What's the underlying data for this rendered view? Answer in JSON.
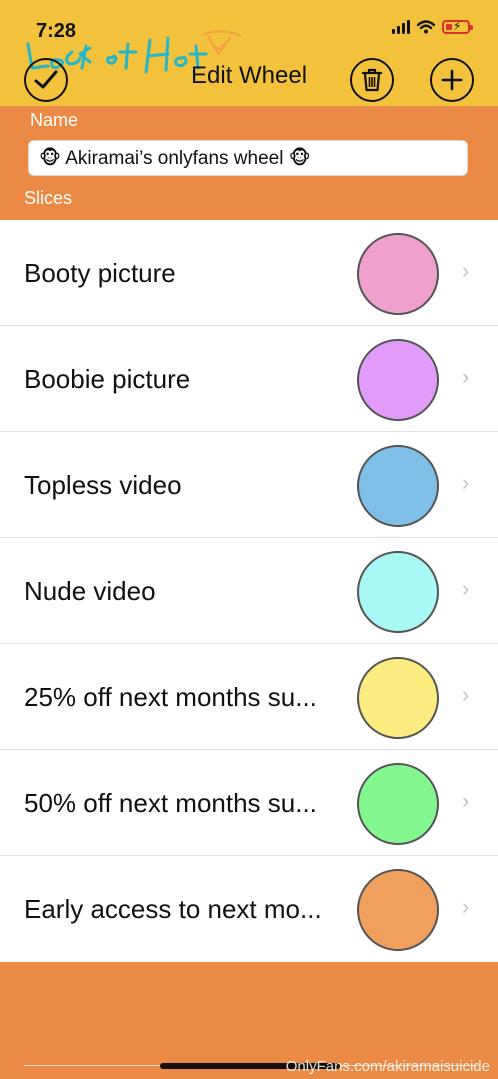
{
  "status_bar": {
    "time": "7:28"
  },
  "header": {
    "title": "Edit Wheel",
    "confirm_icon": "checkmark-circle-icon",
    "delete_icon": "trash-icon",
    "add_icon": "plus-icon"
  },
  "form": {
    "name_label": "Name",
    "name_value": "🐵 Akiramai’s onlyfans wheel 🐵",
    "slices_label": "Slices"
  },
  "slices": [
    {
      "label": "Booty picture",
      "color": "#f0a0cc"
    },
    {
      "label": "Boobie picture",
      "color": "#e09cf8"
    },
    {
      "label": "Topless video",
      "color": "#80c0e8"
    },
    {
      "label": "Nude video",
      "color": "#a8f8f6"
    },
    {
      "label": "25% off next months su...",
      "color": "#fcec80"
    },
    {
      "label": "50% off next months su...",
      "color": "#84f890"
    },
    {
      "label": "Early access to next mo...",
      "color": "#f0a05c"
    }
  ],
  "overlay": {
    "logo_text": "Hot Leak",
    "site_watermark": "OnlyFans.com/akiramaisuicide"
  },
  "colors": {
    "header_bg": "#f2c23c",
    "accent_orange": "#ec8a45"
  }
}
